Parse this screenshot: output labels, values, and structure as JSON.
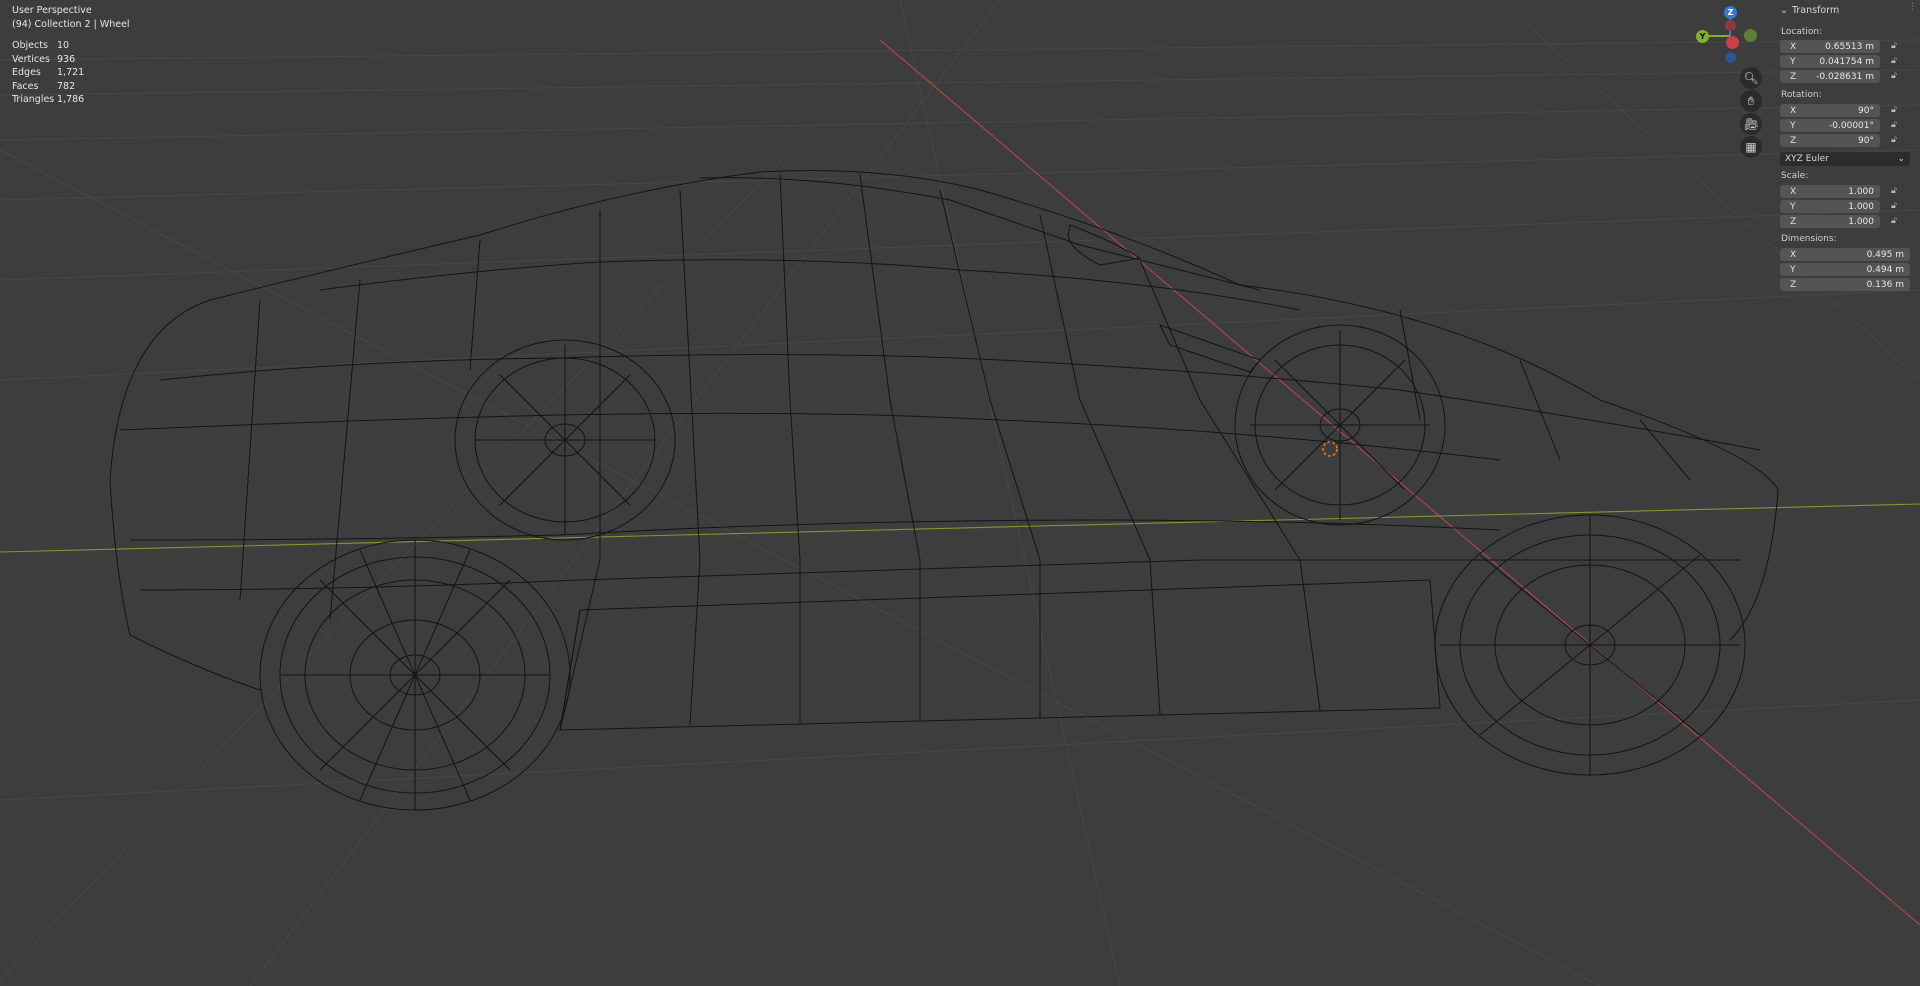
{
  "viewport": {
    "title": "User Perspective",
    "collection": "(94) Collection 2 | Wheel",
    "stats": [
      {
        "label": "Objects",
        "value": "10"
      },
      {
        "label": "Vertices",
        "value": "936"
      },
      {
        "label": "Edges",
        "value": "1,721"
      },
      {
        "label": "Faces",
        "value": "782"
      },
      {
        "label": "Triangles",
        "value": "1,786"
      }
    ]
  },
  "gizmo": {
    "z_label": "Z",
    "y_label": "Y",
    "x_color": "#c9404a",
    "y_color": "#7fb030",
    "z_color": "#3a78d6"
  },
  "nav_icons": [
    "zoom-icon",
    "pan-hand-icon",
    "camera-icon",
    "grid-icon"
  ],
  "transform": {
    "header": "Transform",
    "location_label": "Location:",
    "location": [
      {
        "axis": "X",
        "value": "0.65513 m"
      },
      {
        "axis": "Y",
        "value": "0.041754 m"
      },
      {
        "axis": "Z",
        "value": "-0.028631 m"
      }
    ],
    "rotation_label": "Rotation:",
    "rotation": [
      {
        "axis": "X",
        "value": "90°"
      },
      {
        "axis": "Y",
        "value": "-0.00001°"
      },
      {
        "axis": "Z",
        "value": "90°"
      }
    ],
    "rotation_mode": "XYZ Euler",
    "scale_label": "Scale:",
    "scale": [
      {
        "axis": "X",
        "value": "1.000"
      },
      {
        "axis": "Y",
        "value": "1.000"
      },
      {
        "axis": "Z",
        "value": "1.000"
      }
    ],
    "dimensions_label": "Dimensions:",
    "dimensions": [
      {
        "axis": "X",
        "value": "0.495 m"
      },
      {
        "axis": "Y",
        "value": "0.494 m"
      },
      {
        "axis": "Z",
        "value": "0.136 m"
      }
    ]
  },
  "colors": {
    "background": "#3d3d3d",
    "grid": "#4a4a4a",
    "x_axis_line": "#b5454d",
    "y_axis_line": "#7a9a30",
    "wire": "#111111"
  }
}
